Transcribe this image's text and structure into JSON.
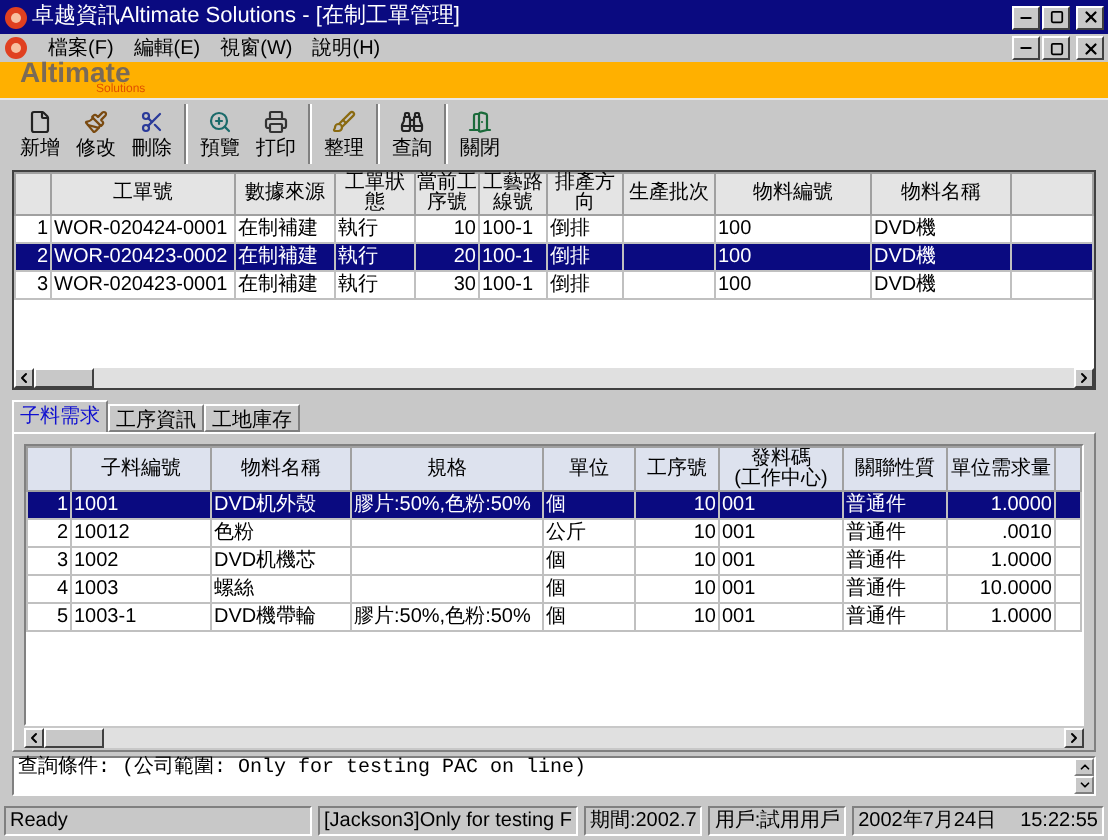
{
  "window": {
    "title": "卓越資訊Altimate Solutions - [在制工單管理]"
  },
  "menu": [
    "檔案(F)",
    "編輯(E)",
    "視窗(W)",
    "說明(H)"
  ],
  "logo": {
    "name": "Altimate",
    "tagline": "Solutions"
  },
  "toolbar": [
    {
      "kind": "new",
      "label": "新增"
    },
    {
      "kind": "edit",
      "label": "修改"
    },
    {
      "kind": "delete",
      "label": "刪除"
    },
    {
      "kind": "preview",
      "label": "預覽"
    },
    {
      "kind": "print",
      "label": "打印"
    },
    {
      "kind": "arrange",
      "label": "整理"
    },
    {
      "kind": "query",
      "label": "查詢"
    },
    {
      "kind": "close",
      "label": "關閉"
    }
  ],
  "work_orders": {
    "columns": [
      {
        "kind": "number"
      },
      {
        "label": "工單號",
        "kind": "text"
      },
      {
        "label": "數據來源",
        "kind": "text"
      },
      {
        "label": "工單狀態",
        "kind": "text"
      },
      {
        "label": "當前工序號",
        "kind": "number"
      },
      {
        "label": "工藝路線號",
        "kind": "text"
      },
      {
        "label": "排產方向",
        "kind": "text"
      },
      {
        "label": "生產批次",
        "kind": "text"
      },
      {
        "label": "物料編號",
        "kind": "text"
      },
      {
        "label": "物料名稱",
        "kind": "text"
      }
    ],
    "rows": [
      {
        "selected": false,
        "cells": [
          "1",
          "WOR-020424-0001",
          "在制補建",
          "執行",
          "10",
          "100-1",
          "倒排",
          "",
          "100",
          "DVD機"
        ]
      },
      {
        "selected": true,
        "cells": [
          "2",
          "WOR-020423-0002",
          "在制補建",
          "執行",
          "20",
          "100-1",
          "倒排",
          "",
          "100",
          "DVD機"
        ]
      },
      {
        "selected": false,
        "cells": [
          "3",
          "WOR-020423-0001",
          "在制補建",
          "執行",
          "30",
          "100-1",
          "倒排",
          "",
          "100",
          "DVD機"
        ]
      }
    ]
  },
  "tabs": [
    {
      "label": "子料需求",
      "selected": true
    },
    {
      "label": "工序資訊",
      "selected": false
    },
    {
      "label": "工地庫存",
      "selected": false
    }
  ],
  "materials": {
    "columns": [
      {
        "kind": "number"
      },
      {
        "label": "子料編號",
        "kind": "text"
      },
      {
        "label": "物料名稱",
        "kind": "text"
      },
      {
        "label": "規格",
        "kind": "text"
      },
      {
        "label": "單位",
        "kind": "text"
      },
      {
        "label": "工序號",
        "kind": "number"
      },
      {
        "label": "發料碼",
        "note": "(工作中心)",
        "kind": "text"
      },
      {
        "label": "關聯性質",
        "kind": "text"
      },
      {
        "label": "單位需求量",
        "kind": "number"
      }
    ],
    "rows": [
      {
        "selected": true,
        "cells": [
          "1",
          "1001",
          "DVD机外殼",
          "膠片:50%,色粉:50%",
          "個",
          "10",
          "001",
          "普通件",
          "1.0000"
        ]
      },
      {
        "selected": false,
        "cells": [
          "2",
          "10012",
          "色粉",
          "",
          "公斤",
          "10",
          "001",
          "普通件",
          ".0010"
        ]
      },
      {
        "selected": false,
        "cells": [
          "3",
          "1002",
          "DVD机機芯",
          "",
          "個",
          "10",
          "001",
          "普通件",
          "1.0000"
        ]
      },
      {
        "selected": false,
        "cells": [
          "4",
          "1003",
          "螺絲",
          "",
          "個",
          "10",
          "001",
          "普通件",
          "10.0000"
        ]
      },
      {
        "selected": false,
        "cells": [
          "5",
          "1003-1",
          "DVD機帶輪",
          "膠片:50%,色粉:50%",
          "個",
          "10",
          "001",
          "普通件",
          "1.0000"
        ]
      }
    ]
  },
  "query": "查詢條件: (公司範圍: Only for testing PAC on line)",
  "status_bar": [
    {
      "texts": [
        "Ready"
      ]
    },
    {
      "texts": [
        "[Jackson3]Only for testing F"
      ]
    },
    {
      "texts": [
        "期間:2002.7"
      ]
    },
    {
      "texts": [
        "用戶:試用用戶"
      ]
    },
    {
      "texts": [
        "2002年7月24日",
        "15:22:55"
      ]
    }
  ]
}
